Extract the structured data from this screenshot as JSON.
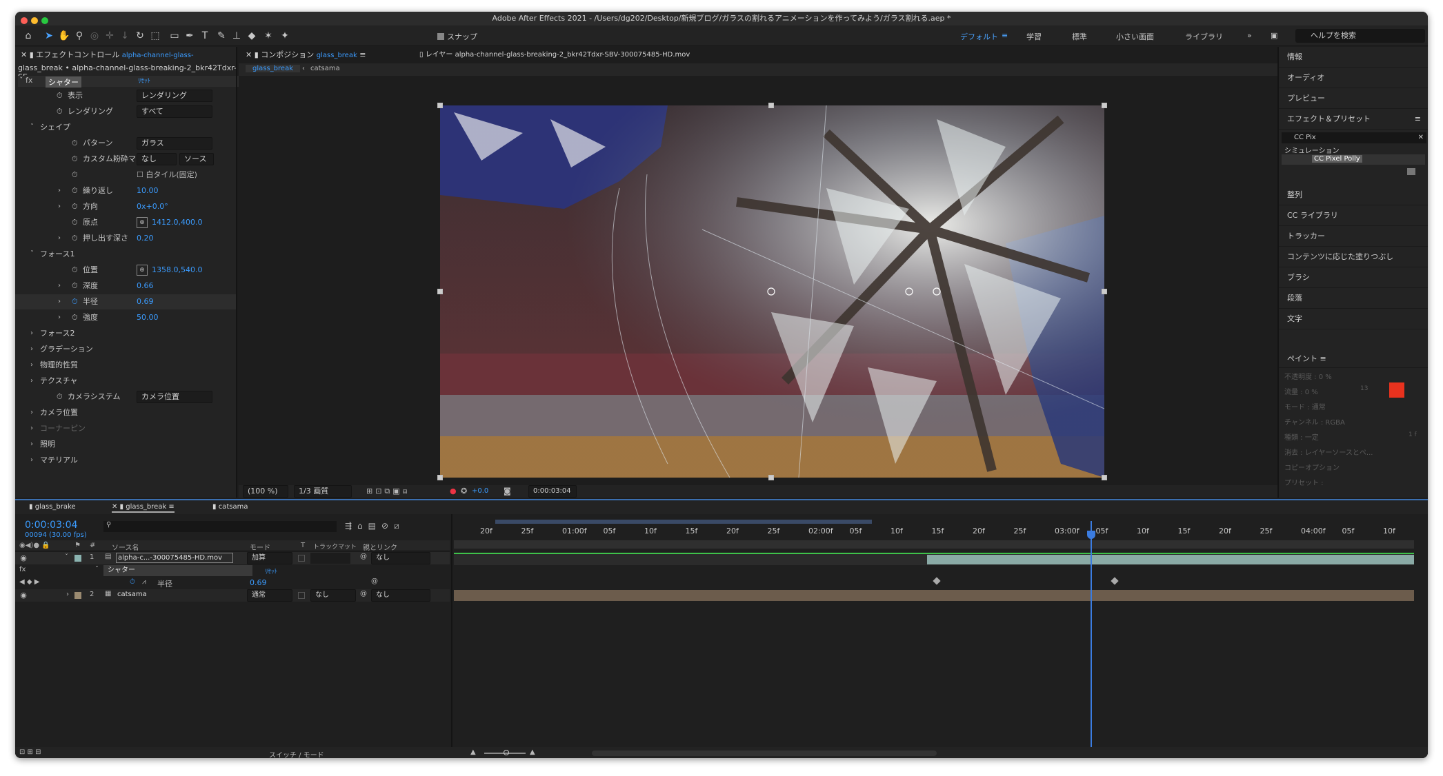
{
  "window": {
    "title": "Adobe After Effects 2021 - /Users/dg202/Desktop/新規ブログ/ガラスの割れるアニメーションを作ってみよう/ガラス割れる.aep *"
  },
  "toolbar": {
    "snap_label": "スナップ",
    "workspaces": [
      "デフォルト",
      "学習",
      "標準",
      "小さい画面",
      "ライブラリ"
    ],
    "help_placeholder": "ヘルプを検索"
  },
  "effect_panel": {
    "tab_label": "エフェクトコントロール",
    "tab_layer": "alpha-channel-glass-",
    "layer_path": "glass_break • alpha-channel-glass-breaking-2_bkr42Tdxr-SE",
    "effect_name": "シャター",
    "reset": "ﾘｾｯﾄ",
    "rows": [
      {
        "label": "表示",
        "dropdown": "レンダリング"
      },
      {
        "label": "レンダリング",
        "dropdown": "すべて"
      },
      {
        "label": "シェイプ"
      },
      {
        "label": "パターン",
        "dropdown": "ガラス"
      },
      {
        "label": "カスタム粉砕マップ",
        "dropdown": "なし",
        "dropdown2": "ソース"
      },
      {
        "label": "",
        "checkbox": "白タイル(固定)"
      },
      {
        "label": "繰り返し",
        "value": "10.00"
      },
      {
        "label": "方向",
        "value": "0x+0.0°"
      },
      {
        "label": "原点",
        "value": "1412.0,400.0"
      },
      {
        "label": "押し出す深さ",
        "value": "0.20"
      },
      {
        "label": "フォース1"
      },
      {
        "label": "位置",
        "value": "1358.0,540.0"
      },
      {
        "label": "深度",
        "value": "0.66"
      },
      {
        "label": "半径",
        "value": "0.69"
      },
      {
        "label": "強度",
        "value": "50.00"
      },
      {
        "label": "フォース2"
      },
      {
        "label": "グラデーション"
      },
      {
        "label": "物理的性質"
      },
      {
        "label": "テクスチャ"
      },
      {
        "label": "カメラシステム",
        "dropdown": "カメラ位置"
      },
      {
        "label": "カメラ位置"
      },
      {
        "label": "コーナーピン"
      },
      {
        "label": "照明"
      },
      {
        "label": "マテリアル"
      }
    ]
  },
  "composition": {
    "tab_label": "コンポジション",
    "tab_comp": "glass_break",
    "layer_tab": "レイヤー alpha-channel-glass-breaking-2_bkr42Tdxr-SBV-300075485-HD.mov",
    "breadcrumbs": [
      "glass_break",
      "catsama"
    ],
    "zoom": "(100 %)",
    "quality": "1/3 画質",
    "exposure": "+0.0",
    "timecode": "0:00:03:04"
  },
  "right_panel": {
    "items_top": [
      "情報",
      "オーディオ",
      "プレビュー"
    ],
    "effects_title": "エフェクト＆プリセット",
    "search": "CC Pix",
    "category": "シミュレーション",
    "result": "CC Pixel Polly",
    "items_bottom": [
      "整列",
      "CC ライブラリ",
      "トラッカー",
      "コンテンツに応じた塗りつぶし",
      "ブラシ",
      "段落",
      "文字"
    ],
    "paint_title": "ペイント",
    "paint_rows": [
      "不透明度 : 0 %",
      "流量 : 0 %",
      "モード : 通常",
      "チャンネル : RGBA",
      "種類 : 一定",
      "消去 : レイヤーソースとペ...",
      "コピーオプション",
      "プリセット :"
    ],
    "paint_side": [
      "13",
      "1 f"
    ],
    "colors": {
      "fg": "#e8321e",
      "bg": "#ffffff"
    }
  },
  "timeline": {
    "tabs": [
      "glass_brake",
      "glass_break",
      "catsama"
    ],
    "timecode": "0:00:03:04",
    "frames": "00094 (30.00 fps)",
    "search_placeholder": "",
    "headers": {
      "num": "#",
      "source": "ソース名",
      "mode": "モード",
      "t": "T",
      "trackmatte": "トラックマット",
      "parent": "親とリンク"
    },
    "layers": [
      {
        "num": "1",
        "name": "alpha-c...-300075485-HD.mov",
        "mode": "加算",
        "parent": "なし"
      },
      {
        "num": "2",
        "name": "catsama",
        "mode": "通常",
        "trackmatte": "なし",
        "parent": "なし"
      }
    ],
    "effect_row": {
      "label": "シャター",
      "reset": "ﾘｾｯﾄ"
    },
    "prop_row": {
      "label": "半径",
      "value": "0.69"
    },
    "ruler": [
      "20f",
      "25f",
      "01:00f",
      "05f",
      "10f",
      "15f",
      "20f",
      "25f",
      "02:00f",
      "05f",
      "10f",
      "15f",
      "20f",
      "25f",
      "03:00f",
      "05f",
      "10f",
      "15f",
      "20f",
      "25f",
      "04:00f",
      "05f",
      "10f"
    ],
    "bottom_label": "スイッチ / モード"
  }
}
